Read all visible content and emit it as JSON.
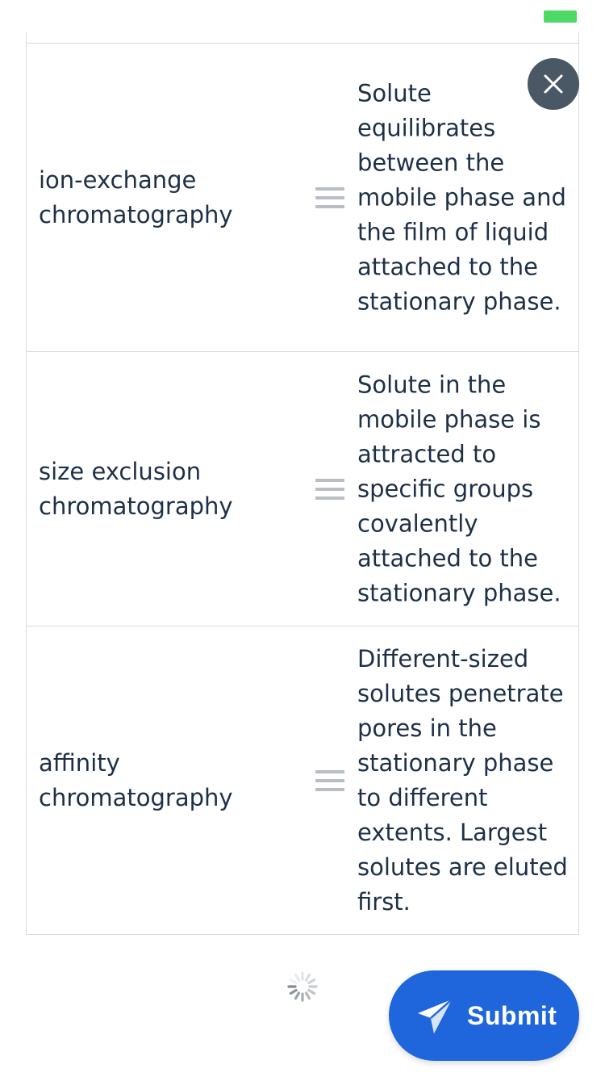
{
  "status_bar": {
    "battery_color": "#4cd964"
  },
  "matching": {
    "rows": [
      {
        "term": "ion-exchange chromatography",
        "definition": "Solute equilibrates between the mobile phase and the film of liquid attached to the stationary phase."
      },
      {
        "term": "size exclusion chromatography",
        "definition": "Solute in the mobile phase is attracted to specific groups covalently attached to the stationary phase."
      },
      {
        "term": "affinity chromatography",
        "definition": "Different-sized solutes penetrate pores in the stationary phase to different extents. Largest solutes are eluted first."
      }
    ],
    "drag_handle_icon": "drag-handle-icon"
  },
  "close_button": {
    "icon": "close-icon",
    "color": "#4a5866"
  },
  "loading": {
    "icon": "spinner-icon"
  },
  "submit": {
    "label": "Submit",
    "icon": "paper-plane-icon",
    "color": "#1f66dc"
  }
}
